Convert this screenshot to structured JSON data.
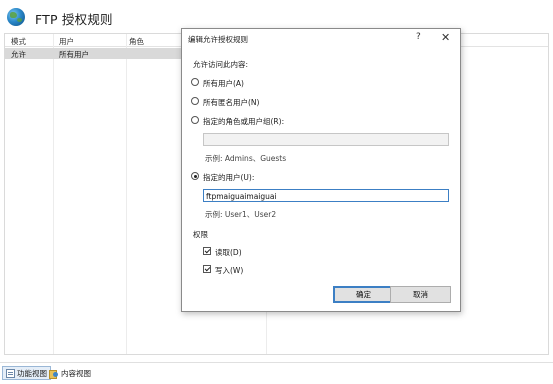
{
  "page": {
    "title": "FTP 授权规则"
  },
  "grid": {
    "columns": [
      "模式",
      "用户",
      "角色"
    ],
    "rows": [
      {
        "mode": "允许",
        "users": "所有用户",
        "roles": ""
      }
    ]
  },
  "bottom_tabs": [
    {
      "label": "功能视图",
      "active": true
    },
    {
      "label": "内容视图",
      "active": false
    }
  ],
  "dialog": {
    "title": "编辑允许授权规则",
    "help_glyph": "?",
    "close_glyph": "✕",
    "access_label": "允许访问此内容:",
    "options": [
      {
        "label": "所有用户(A)",
        "checked": false
      },
      {
        "label": "所有匿名用户(N)",
        "checked": false
      },
      {
        "label": "指定的角色或用户组(R):",
        "checked": false
      },
      {
        "label": "指定的用户(U):",
        "checked": true
      }
    ],
    "roles_value": "",
    "roles_example": "示例: Admins、Guests",
    "users_value": "ftpmaiguaimaiguai",
    "users_example": "示例: User1、User2",
    "permissions_label": "权限",
    "permissions": [
      {
        "label": "读取(D)",
        "checked": true
      },
      {
        "label": "写入(W)",
        "checked": true
      }
    ],
    "ok_label": "确定",
    "cancel_label": "取消"
  }
}
